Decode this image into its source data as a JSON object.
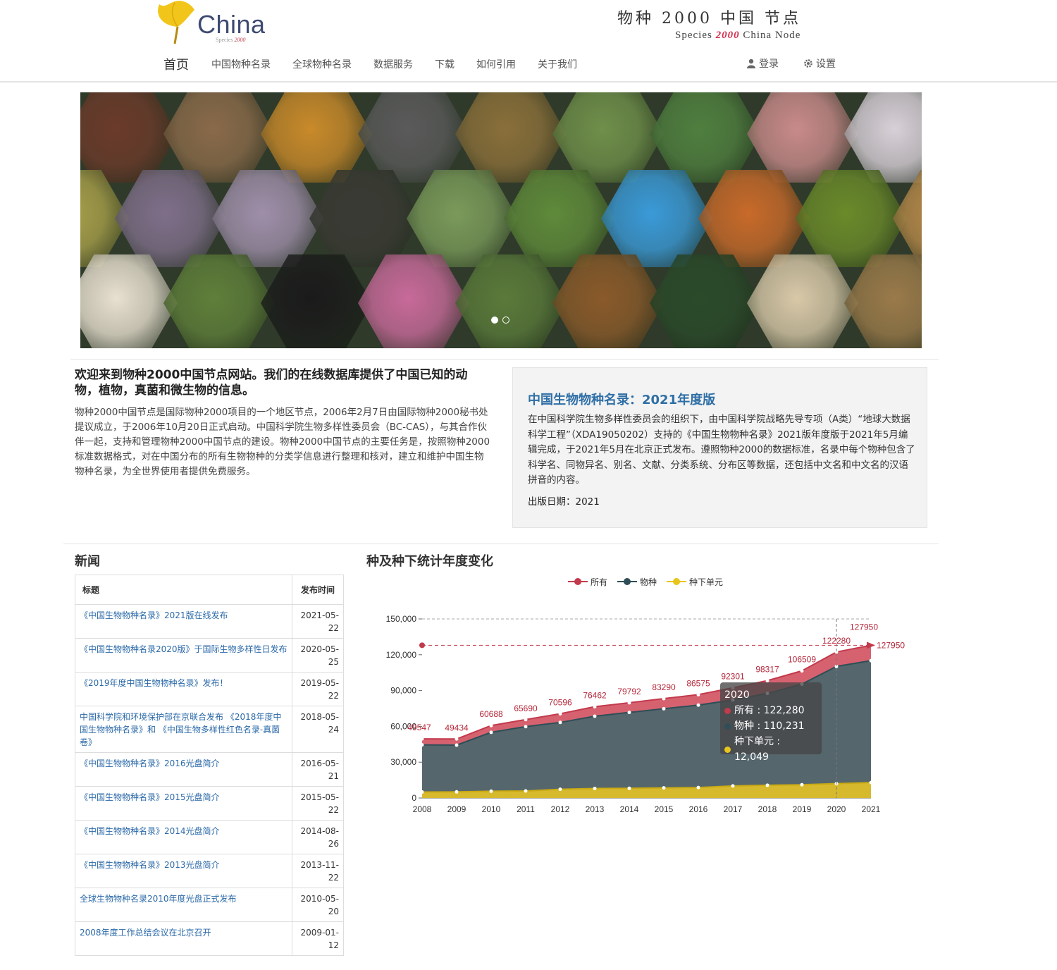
{
  "header": {
    "logo_text": "China",
    "logo_sub_prefix": "Species",
    "logo_sub_num": "2000",
    "site_title": "物种 2000 中国 节点",
    "site_sub_prefix": "Species",
    "site_sub_num": "2000",
    "site_sub_suffix": "China Node"
  },
  "nav": {
    "items": [
      "首页",
      "中国物种名录",
      "全球物种名录",
      "数据服务",
      "下载",
      "如何引用",
      "关于我们"
    ],
    "login": "登录",
    "settings": "设置"
  },
  "intro": {
    "title": "欢迎来到物种2000中国节点网站。我们的在线数据库提供了中国已知的动物，植物，真菌和微生物的信息。",
    "body": "物种2000中国节点是国际物种2000项目的一个地区节点，2006年2月7日由国际物种2000秘书处提议成立，于2006年10月20日正式启动。中国科学院生物多样性委员会（BC-CAS），与其合作伙伴一起，支持和管理物种2000中国节点的建设。物种2000中国节点的主要任务是，按照物种2000标准数据格式，对在中国分布的所有生物物种的分类学信息进行整理和核对，建立和维护中国生物物种名录，为全世界使用者提供免费服务。"
  },
  "release": {
    "title": "中国生物物种名录：2021年度版",
    "body": "在中国科学院生物多样性委员会的组织下，由中国科学院战略先导专项（A类）“地球大数据科学工程”（XDA19050202）支持的《中国生物物种名录》2021版年度版于2021年5月编辑完成，于2021年5月在北京正式发布。遵照物种2000的数据标准，名录中每个物种包含了科学名、同物异名、别名、文献、分类系统、分布区等数据，还包括中文名和中文名的汉语拼音的内容。",
    "date": "出版日期：2021"
  },
  "news": {
    "heading": "新闻",
    "col_title": "标题",
    "col_date": "发布时间",
    "rows": [
      {
        "title": "《中国生物物种名录》2021版在线发布",
        "date": "2021-05-22"
      },
      {
        "title": "《中国生物物种名录2020版》于国际生物多样性日发布",
        "date": "2020-05-25"
      },
      {
        "title": "《2019年度中国生物物种名录》发布！",
        "date": "2019-05-22"
      },
      {
        "title": "中国科学院和环境保护部在京联合发布 《2018年度中国生物物种名录》和 《中国生物多样性红色名录-真菌卷》",
        "date": "2018-05-24"
      },
      {
        "title": "《中国生物物种名录》2016光盘简介",
        "date": "2016-05-21"
      },
      {
        "title": "《中国生物物种名录》2015光盘简介",
        "date": "2015-05-22"
      },
      {
        "title": "《中国生物物种名录》2014光盘简介",
        "date": "2014-08-26"
      },
      {
        "title": "《中国生物物种名录》2013光盘简介",
        "date": "2013-11-22"
      },
      {
        "title": "全球生物物种名录2010年度光盘正式发布",
        "date": "2010-05-20"
      },
      {
        "title": "2008年度工作总结会议在北京召开",
        "date": "2009-01-12"
      }
    ]
  },
  "chart_heading": "种及种下统计年度变化",
  "chart_data": {
    "type": "area",
    "title": "种及种下统计年度变化",
    "categories": [
      "2008",
      "2009",
      "2010",
      "2011",
      "2012",
      "2013",
      "2014",
      "2015",
      "2016",
      "2017",
      "2018",
      "2019",
      "2020",
      "2021"
    ],
    "series": [
      {
        "name": "所有",
        "color": "#c23a4c",
        "values": [
          49547,
          49434,
          60688,
          65690,
          70596,
          76462,
          79792,
          83290,
          86575,
          92301,
          98317,
          106509,
          122280,
          127950
        ]
      },
      {
        "name": "物种",
        "color": "#2f4e57",
        "values": [
          44500,
          44300,
          55000,
          59800,
          63300,
          68500,
          71700,
          74800,
          77800,
          82200,
          87600,
          95400,
          110231,
          115064
        ]
      },
      {
        "name": "种下单元",
        "color": "#e8c51d",
        "values": [
          5047,
          5134,
          5688,
          5890,
          7296,
          7962,
          8092,
          8490,
          8775,
          10101,
          10717,
          11109,
          12049,
          12886
        ]
      }
    ],
    "ylim": [
      0,
      150000
    ],
    "yticks": [
      "0",
      "30,000",
      "60,000",
      "90,000",
      "120,000",
      "150,000"
    ],
    "max_marker": "127950",
    "legend_position": "top",
    "grid": false
  },
  "tooltip": {
    "year": "2020",
    "all": "所有 : 122,280",
    "species": "物种 : 110,231",
    "infra": "种下单元 : 12,049"
  }
}
